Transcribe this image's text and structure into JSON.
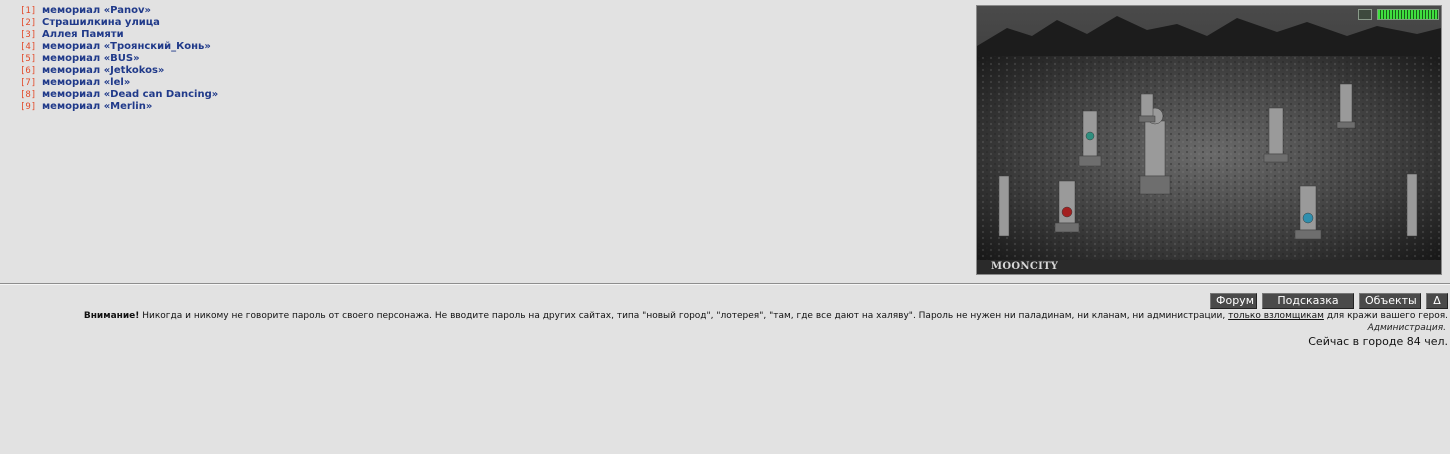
{
  "locations": [
    {
      "num": "[1]",
      "label": "мемориал «Panov»"
    },
    {
      "num": "[2]",
      "label": "Страшилкина улица"
    },
    {
      "num": "[3]",
      "label": "Аллея Памяти"
    },
    {
      "num": "[4]",
      "label": "мемориал «Троянский_Конь»"
    },
    {
      "num": "[5]",
      "label": "мемориал «BUS»"
    },
    {
      "num": "[6]",
      "label": "мемориал «Jetkokos»"
    },
    {
      "num": "[7]",
      "label": "мемориал «lel»"
    },
    {
      "num": "[8]",
      "label": "мемориал «Dead can Dancing»"
    },
    {
      "num": "[9]",
      "label": "мемориал «Merlin»"
    }
  ],
  "scene": {
    "location_name": "MOONCITY",
    "health_bar_color": "#3fe03f"
  },
  "nav": {
    "forum": "Форум",
    "hint": "Подсказка",
    "objects": "Объекты",
    "delta": "Δ"
  },
  "warning": {
    "prefix": "Внимание!",
    "text": "Никогда и никому не говорите пароль от своего персонажа. Не вводите пароль на других сайтах, типа \"новый город\", \"лотерея\", \"там, где все дают на халяву\". Пароль не нужен ни паладинам, ни кланам, ни администрации,",
    "link": "только взломщикам",
    "suffix": "для кражи вашего героя.",
    "signature": "Администрация."
  },
  "online": "Сейчас в городе 84 чел.",
  "colors": {
    "background": "#e2e2e2",
    "link_blue": "#203a8a",
    "number_red": "#e24a2a",
    "button_bg": "#4a4a4a"
  }
}
